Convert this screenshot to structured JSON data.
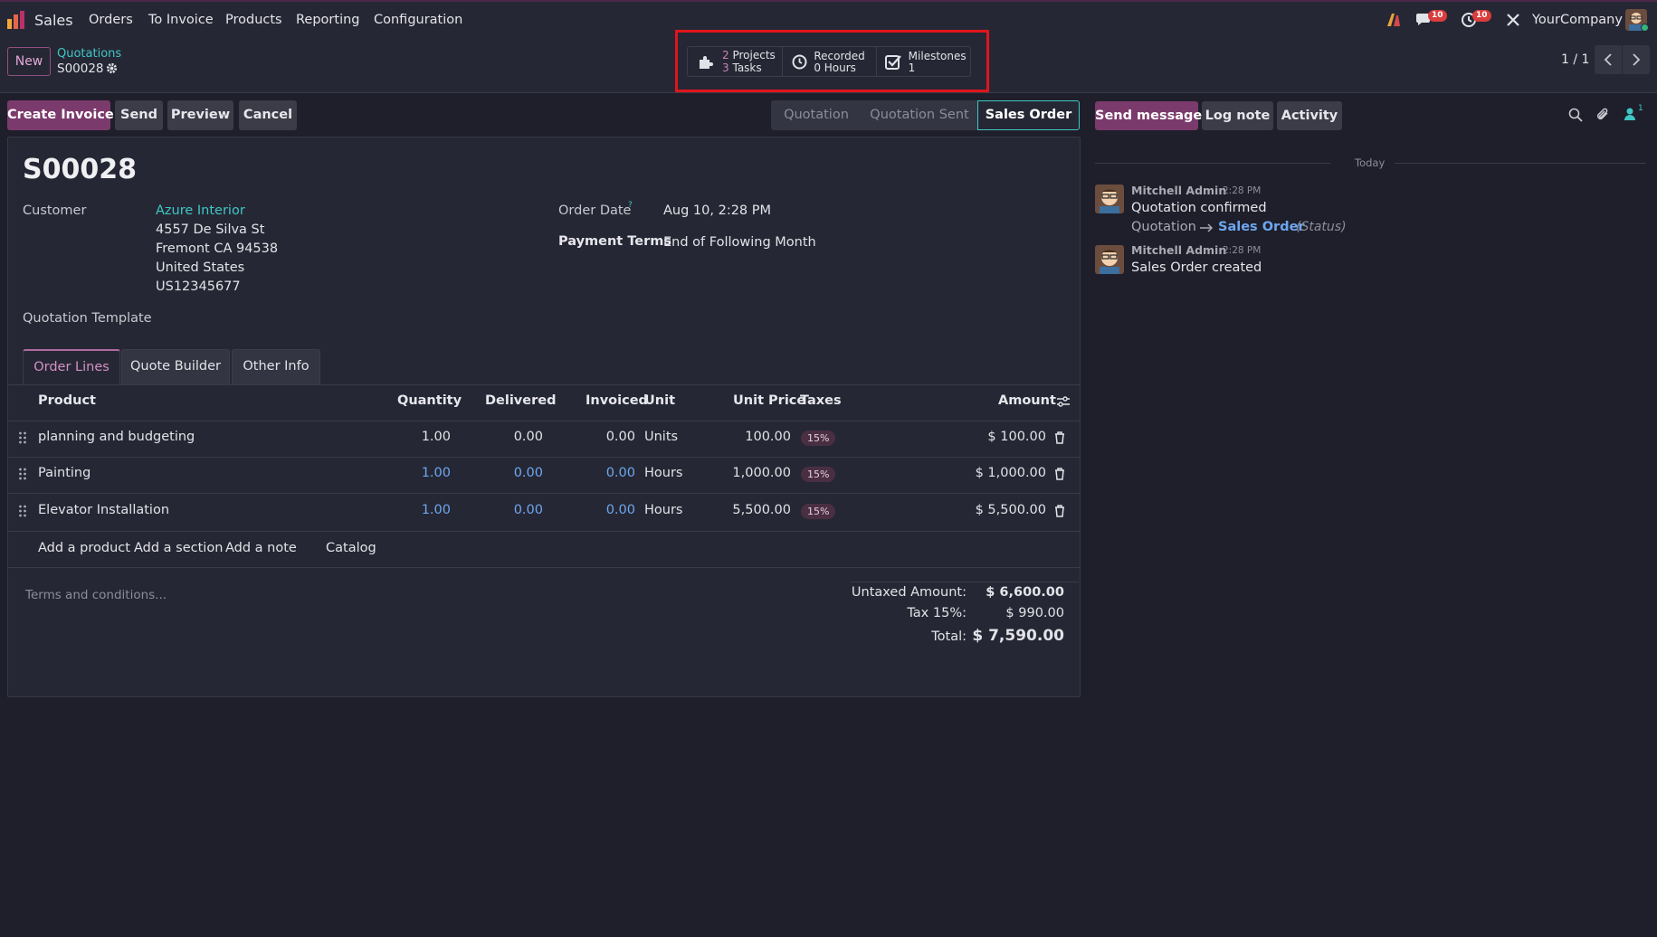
{
  "navbar": {
    "app_name": "Sales",
    "menu": [
      "Orders",
      "To Invoice",
      "Products",
      "Reporting",
      "Configuration"
    ],
    "chat_badge": "10",
    "activity_badge": "10",
    "company": "YourCompany"
  },
  "control_panel": {
    "new_label": "New",
    "breadcrumb_parent": "Quotations",
    "record_name": "S00028",
    "pager": "1 / 1",
    "smart_buttons": {
      "projects_count": "2",
      "projects_label": "Projects",
      "tasks_count": "3",
      "tasks_label": "Tasks",
      "recorded_label": "Recorded",
      "recorded_value": "0 Hours",
      "milestones_label": "Milestones",
      "milestones_count": "1"
    }
  },
  "actions": {
    "create_invoice": "Create Invoice",
    "send": "Send",
    "preview": "Preview",
    "cancel": "Cancel"
  },
  "status_bar": [
    "Quotation",
    "Quotation Sent",
    "Sales Order"
  ],
  "status_active": "Sales Order",
  "form": {
    "title": "S00028",
    "customer_label": "Customer",
    "customer_name": "Azure Interior",
    "address": [
      "4557 De Silva St",
      "Fremont CA 94538",
      "United States",
      "US12345677"
    ],
    "order_date_label": "Order Date",
    "order_date_help": "?",
    "order_date": "Aug 10, 2:28 PM",
    "payment_terms_label": "Payment Terms",
    "payment_terms": "End of Following Month",
    "quotation_template_label": "Quotation Template",
    "tabs": [
      "Order Lines",
      "Quote Builder",
      "Other Info"
    ],
    "columns": {
      "product": "Product",
      "quantity": "Quantity",
      "delivered": "Delivered",
      "invoiced": "Invoiced",
      "unit": "Unit",
      "unit_price": "Unit Price",
      "taxes": "Taxes",
      "amount": "Amount"
    },
    "lines": [
      {
        "product": "planning and budgeting",
        "quantity": "1.00",
        "delivered": "0.00",
        "invoiced": "0.00",
        "unit": "Units",
        "unit_price": "100.00",
        "tax": "15%",
        "amount": "$ 100.00"
      },
      {
        "product": "Painting",
        "quantity": "1.00",
        "delivered": "0.00",
        "invoiced": "0.00",
        "unit": "Hours",
        "unit_price": "1,000.00",
        "tax": "15%",
        "amount": "$ 1,000.00"
      },
      {
        "product": "Elevator Installation",
        "quantity": "1.00",
        "delivered": "0.00",
        "invoiced": "0.00",
        "unit": "Hours",
        "unit_price": "5,500.00",
        "tax": "15%",
        "amount": "$ 5,500.00"
      }
    ],
    "add_links": [
      "Add a product",
      "Add a section",
      "Add a note",
      "Catalog"
    ],
    "terms_placeholder": "Terms and conditions...",
    "totals": {
      "untaxed_label": "Untaxed Amount:",
      "untaxed_value": "$ 6,600.00",
      "tax_label": "Tax 15%:",
      "tax_value": "$ 990.00",
      "total_label": "Total:",
      "total_value": "$ 7,590.00"
    }
  },
  "chatter": {
    "send_message": "Send message",
    "log_note": "Log note",
    "activity": "Activity",
    "followers_count": "1",
    "date_separator": "Today",
    "messages": [
      {
        "author": "Mitchell Admin",
        "time": "2:28 PM",
        "body": "Quotation confirmed",
        "change_from": "Quotation",
        "change_to": "Sales Order",
        "change_field": "(Status)"
      },
      {
        "author": "Mitchell Admin",
        "time": "2:28 PM",
        "body": "Sales Order created"
      }
    ]
  },
  "colors": {
    "background": "#1f1f2b",
    "panel": "#262734",
    "primary": "#7b3a6c",
    "link": "#3fc6c6",
    "highlight": "#e0151c"
  }
}
